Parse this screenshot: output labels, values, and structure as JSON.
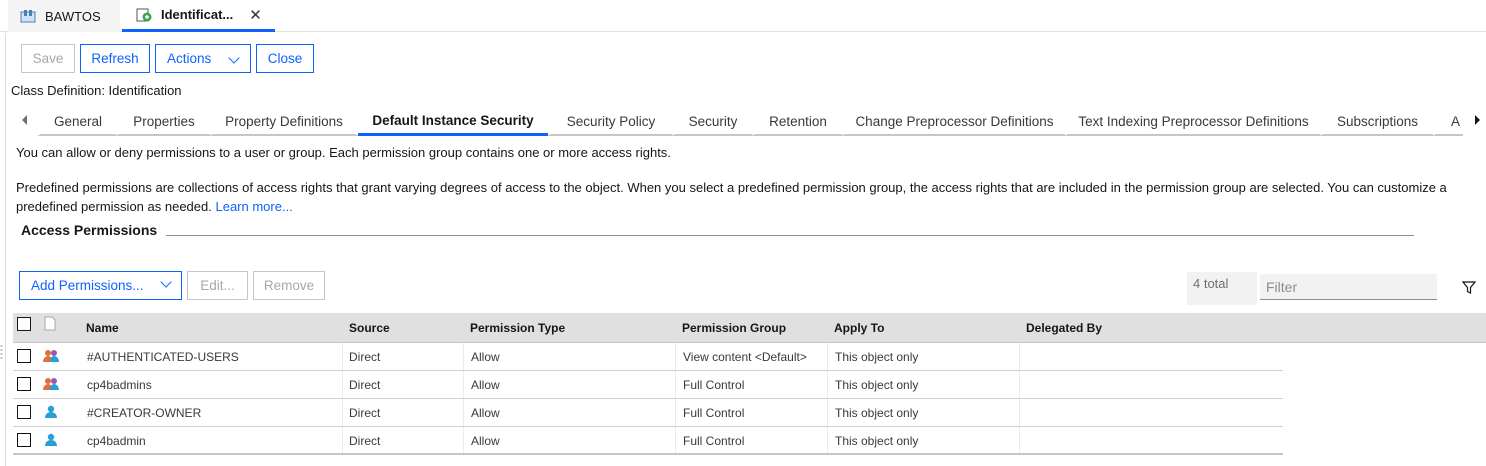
{
  "top_tabs": [
    {
      "label": "BAWTOS",
      "icon": "object-store-icon"
    },
    {
      "label": "Identificat...",
      "icon": "class-definition-icon",
      "close_symbol": "✕"
    }
  ],
  "toolbar": {
    "save_label": "Save",
    "refresh_label": "Refresh",
    "actions_label": "Actions",
    "close_label": "Close"
  },
  "class_definition_label": "Class Definition: Identification",
  "sub_tabs": [
    "General",
    "Properties",
    "Property Definitions",
    "Default Instance Security",
    "Security Policy",
    "Security",
    "Retention",
    "Change Preprocessor Definitions",
    "Text Indexing Preprocessor Definitions",
    "Subscriptions",
    "A"
  ],
  "active_sub_tab": "Default Instance Security",
  "description": {
    "line1": "You can allow or deny permissions to a user or group. Each permission group contains one or more access rights.",
    "line2": "Predefined permissions are collections of access rights that grant varying degrees of access to the object. When you select a predefined permission group, the access rights that are included in the permission group are selected. You can customize a",
    "line3": "predefined permission as needed.",
    "learn_more": "Learn more..."
  },
  "section_title": "Access Permissions",
  "permission_toolbar": {
    "add_label": "Add Permissions...",
    "edit_label": "Edit...",
    "remove_label": "Remove"
  },
  "total_label": "4 total",
  "filter_placeholder": "Filter",
  "table": {
    "columns": [
      "Name",
      "Source",
      "Permission Type",
      "Permission Group",
      "Apply To",
      "Delegated By"
    ],
    "rows": [
      {
        "icon": "group-icon",
        "name": "#AUTHENTICATED-USERS",
        "source": "Direct",
        "type": "Allow",
        "group": "View content <Default>",
        "apply_to": "This object only",
        "delegated_by": ""
      },
      {
        "icon": "group-icon",
        "name": "cp4badmins",
        "source": "Direct",
        "type": "Allow",
        "group": "Full Control",
        "apply_to": "This object only",
        "delegated_by": ""
      },
      {
        "icon": "user-icon",
        "name": "#CREATOR-OWNER",
        "source": "Direct",
        "type": "Allow",
        "group": "Full Control",
        "apply_to": "This object only",
        "delegated_by": ""
      },
      {
        "icon": "user-icon",
        "name": "cp4badmin",
        "source": "Direct",
        "type": "Allow",
        "group": "Full Control",
        "apply_to": "This object only",
        "delegated_by": ""
      }
    ]
  },
  "colors": {
    "accent": "#0f62fe",
    "header_bg": "#e0e0e0",
    "group_icon": "#e06f3c",
    "user_icon": "#2a9fd6"
  }
}
